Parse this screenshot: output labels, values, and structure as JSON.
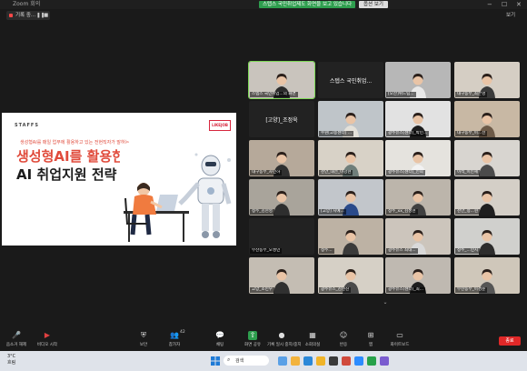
{
  "window": {
    "app_title": "Zoom 회의",
    "banner": "스텝스 국민취업제도 화면을 보고 있습니다",
    "view_button": "옵션 보기",
    "controls": [
      "−",
      "☐",
      "✕"
    ],
    "view_label": "보기"
  },
  "recording": {
    "label": "기록 중...",
    "pause": "❚❚",
    "stop": "■"
  },
  "slide": {
    "logo": "STAFFS",
    "badge": "LIKEJOB",
    "subtitle": "생성형AI를 매일 업무에 활용하고 있는 전현직자가 말하는",
    "title_line1": "생성형AI를 활용한",
    "title_line2": "AI 취업지원 전략"
  },
  "participants": [
    {
      "name": "스텝스 국민취업...의 화면",
      "type": "cam",
      "bg": "#c9c4bd",
      "shirt": "#2c2c2c",
      "active": true
    },
    {
      "name": "스텝스 국민취업...",
      "type": "dark",
      "center": "스텝스 국민취업..."
    },
    {
      "name": "[오산]위드팀...",
      "type": "cam",
      "bg": "#b7b7b7",
      "shirt": "#e8e8e8"
    },
    {
      "name": "대구동부_최은영",
      "type": "cam",
      "bg": "#d5cec4",
      "shirt": "#3a3a3a"
    },
    {
      "name": "[고양]_조정욱",
      "type": "dark",
      "center": "[고양]_조정욱"
    },
    {
      "name": "수원[고용센터] ...",
      "type": "cam",
      "bg": "#bfc5c9",
      "shirt": "#e4e1d9"
    },
    {
      "name": "광주유스[센터]_박민...",
      "type": "cam",
      "bg": "#e2e2e2",
      "shirt": "#1e1e1e"
    },
    {
      "name": "대구동부_이...선",
      "type": "cam",
      "bg": "#c8b8a4",
      "shirt": "#6d5a48"
    },
    {
      "name": "대구동부_차민하",
      "type": "cam",
      "bg": "#b6a99a",
      "shirt": "#2f2f2f"
    },
    {
      "name": "천안_대전_이강현",
      "type": "cam",
      "bg": "#d8d2c7",
      "shirt": "#6f7e7a"
    },
    {
      "name": "광주유스[센터]_인희",
      "type": "cam",
      "bg": "#e5e3de",
      "shirt": "#f2f2f2"
    },
    {
      "name": "이석_이인혜",
      "type": "cam",
      "bg": "#d8d5d0",
      "shirt": "#4b4b4b"
    },
    {
      "name": "청주_김현영",
      "type": "cam",
      "bg": "#a9a49b",
      "shirt": "#2e2e2e"
    },
    {
      "name": "[고양] 지예...",
      "type": "cam",
      "bg": "#c2c6cb",
      "shirt": "#2a4a8a"
    },
    {
      "name": "청주_xx_김성현",
      "type": "cam",
      "bg": "#bcb5ab",
      "shirt": "#404040"
    },
    {
      "name": "천안_정...현",
      "type": "cam",
      "bg": "#d4cfc7",
      "shirt": "#1f1f1f"
    },
    {
      "name": "부산동부_오성민",
      "type": "dark",
      "center": ""
    },
    {
      "name": "청주...",
      "type": "cam",
      "bg": "#bdb2a4",
      "shirt": "#3a3a3a"
    },
    {
      "name": "광주유스 최태...",
      "type": "cam",
      "bg": "#ccc5bc",
      "shirt": "#d9d9d9"
    },
    {
      "name": "청주_...민지",
      "type": "cam",
      "bg": "#d0d0cd",
      "shirt": "#2d2d2d"
    },
    {
      "name": "고양_조민우",
      "type": "cam",
      "bg": "#c4bdb3",
      "shirt": "#303030"
    },
    {
      "name": "광주유스_김현진",
      "type": "cam",
      "bg": "#d6d0c6",
      "shirt": "#4a4a4a"
    },
    {
      "name": "광주유스(센터)_최...",
      "type": "cam",
      "bg": "#bfb9b1",
      "shirt": "#1d1d1d"
    },
    {
      "name": "부산동부_이경준",
      "type": "cam",
      "bg": "#cfc7ba",
      "shirt": "#555555"
    }
  ],
  "toolbar": {
    "items": [
      {
        "label": "음소거 해제",
        "icon": "microphone-icon"
      },
      {
        "label": "비디오 시작",
        "icon": "video-icon"
      },
      {
        "label": "보안",
        "icon": "shield-icon"
      },
      {
        "label": "참가자",
        "icon": "participants-icon",
        "count": "42"
      },
      {
        "label": "채팅",
        "icon": "chat-icon"
      },
      {
        "label": "화면 공유",
        "icon": "share-screen-icon"
      },
      {
        "label": "기록 일시 중지/중지",
        "icon": "record-icon"
      },
      {
        "label": "소회의실",
        "icon": "breakout-icon"
      },
      {
        "label": "반응",
        "icon": "reaction-icon"
      },
      {
        "label": "앱",
        "icon": "apps-icon"
      },
      {
        "label": "화이트보드",
        "icon": "whiteboard-icon"
      }
    ],
    "end_label": "종료",
    "participant_count": "42"
  },
  "taskbar": {
    "weather_temp": "3°C",
    "weather_desc": "흐림",
    "search_text": "검색",
    "time": "",
    "date": ""
  },
  "colors": {
    "share_green": "#2e9e4e",
    "end_red": "#e02828",
    "active_speaker": "#7ed957",
    "slide_accent": "#e04b3c"
  }
}
